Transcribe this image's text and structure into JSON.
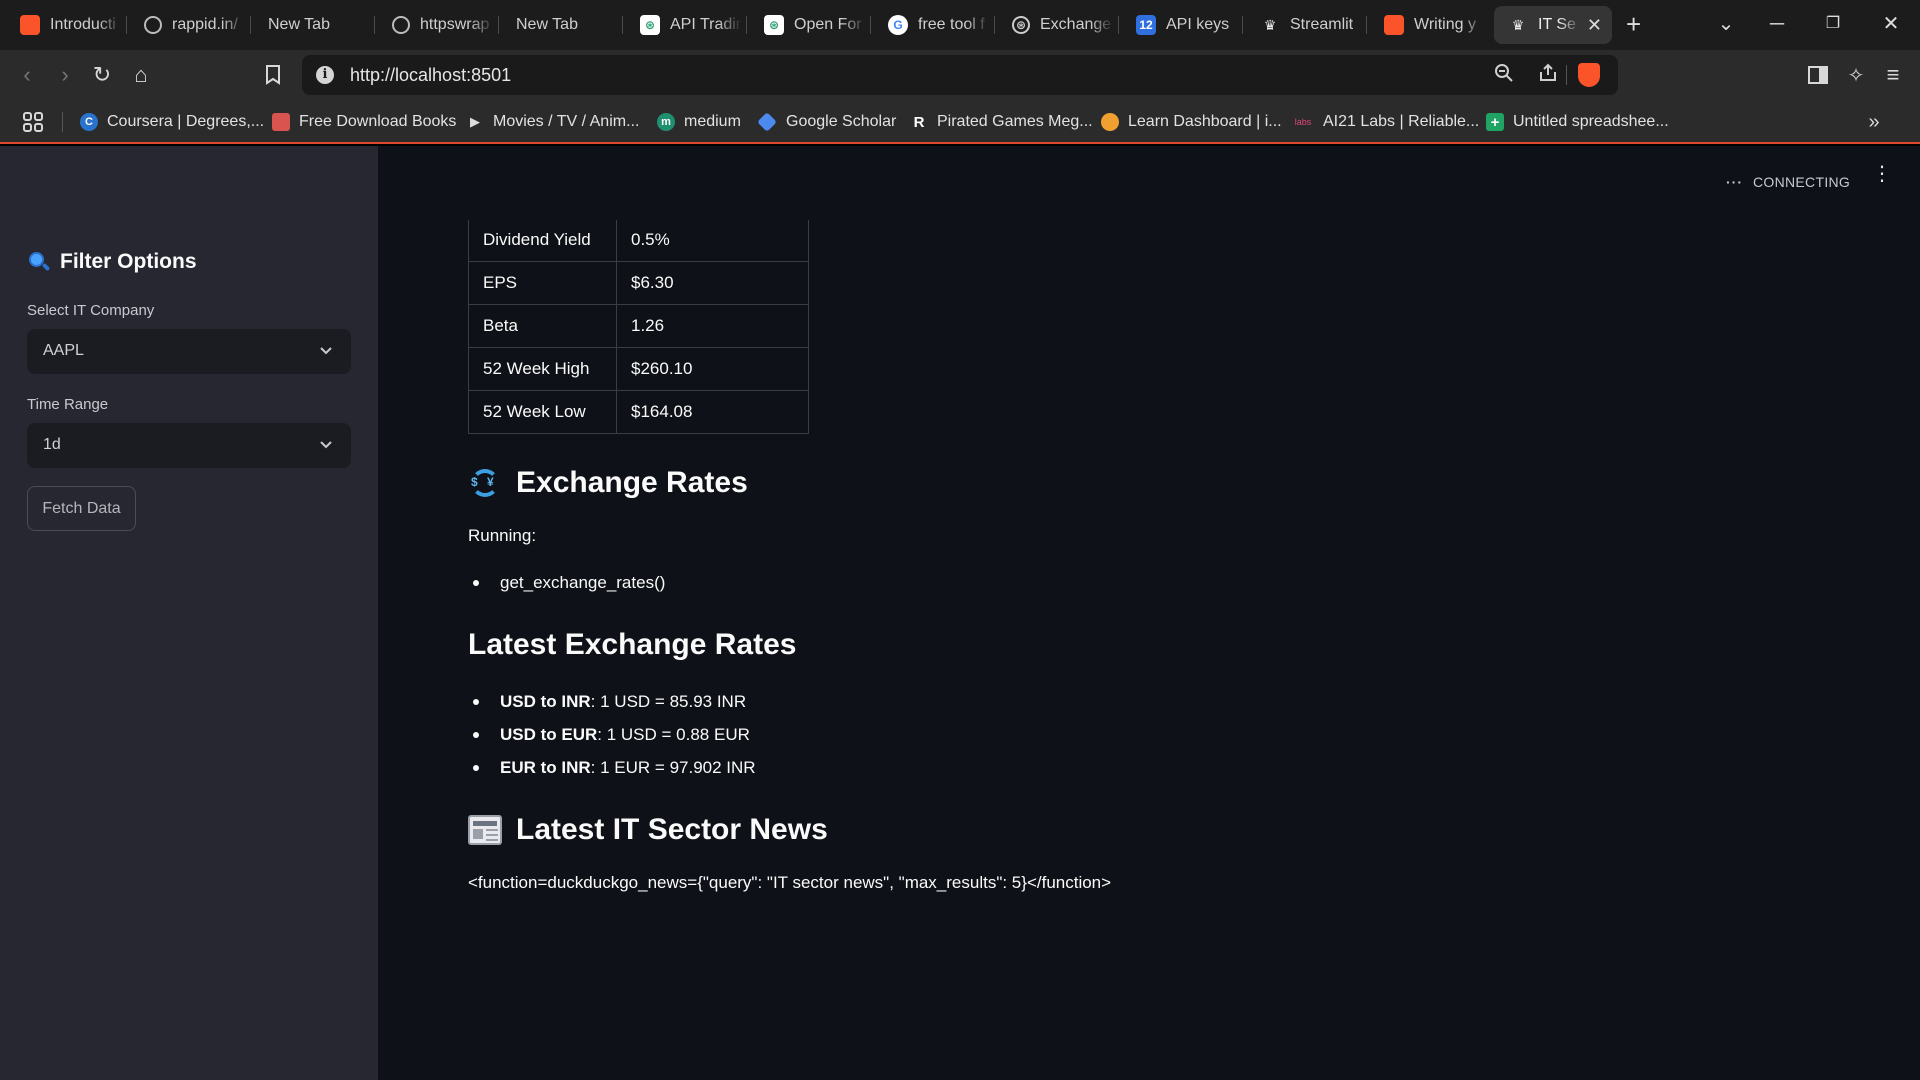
{
  "browser": {
    "tabs": [
      {
        "label": "Introducti",
        "icon": "orange-square-icon",
        "color": "#fb542b"
      },
      {
        "label": "rappid.in/",
        "icon": "globe-icon",
        "color": "#555555"
      },
      {
        "label": "New Tab",
        "icon": "",
        "color": ""
      },
      {
        "label": "httpswrap",
        "icon": "globe-icon",
        "color": "#555555"
      },
      {
        "label": "New Tab",
        "icon": "",
        "color": ""
      },
      {
        "label": "API Tradin",
        "icon": "openai-icon",
        "color": "#ffffff"
      },
      {
        "label": "Open For",
        "icon": "openai-icon",
        "color": "#ffffff"
      },
      {
        "label": "free tool f",
        "icon": "google-icon",
        "color": "#ffffff"
      },
      {
        "label": "Exchange",
        "icon": "openai-icon",
        "color": "#555555"
      },
      {
        "label": "API keys",
        "icon": "12-icon",
        "color": "#2f6fde"
      },
      {
        "label": "Streamlit",
        "icon": "streamlit-icon",
        "color": "#1c1c1c"
      },
      {
        "label": "Writing y",
        "icon": "orange-square-icon",
        "color": "#fb542b"
      },
      {
        "label": "IT Se",
        "icon": "streamlit-icon",
        "color": "#353535"
      }
    ],
    "url": "http://localhost:8501",
    "bookmarks": [
      {
        "label": "Coursera | Degrees,...",
        "icon_text": "C",
        "color": "#2a73cc"
      },
      {
        "label": "Free Download Books",
        "icon_text": "",
        "color": "#d9534f"
      },
      {
        "label": "Movies / TV / Anim...",
        "icon_text": "▶",
        "color": "#2b2b2b"
      },
      {
        "label": "medium",
        "icon_text": "m",
        "color": "#1f8f6f"
      },
      {
        "label": "Google Scholar",
        "icon_text": "",
        "color": "#4d8af0"
      },
      {
        "label": "Pirated Games Meg...",
        "icon_text": "R",
        "color": "#2b2b2b"
      },
      {
        "label": "Learn Dashboard | i...",
        "icon_text": "",
        "color": "#f0a030"
      },
      {
        "label": "AI21 Labs | Reliable...",
        "icon_text": "labs",
        "color": "#2b2b2b"
      },
      {
        "label": "Untitled spreadshee...",
        "icon_text": "+",
        "color": "#1fa463"
      }
    ]
  },
  "app": {
    "status": "CONNECTING",
    "sidebar": {
      "title": "Filter Options",
      "company_label": "Select IT Company",
      "company_value": "AAPL",
      "range_label": "Time Range",
      "range_value": "1d",
      "fetch_button": "Fetch Data"
    },
    "metrics": [
      {
        "key": "Dividend Yield",
        "value": "0.5%"
      },
      {
        "key": "EPS",
        "value": "$6.30"
      },
      {
        "key": "Beta",
        "value": "1.26"
      },
      {
        "key": "52 Week High",
        "value": "$260.10"
      },
      {
        "key": "52 Week Low",
        "value": "$164.08"
      }
    ],
    "exchange": {
      "heading": "Exchange Rates",
      "running_label": "Running:",
      "running_item": "get_exchange_rates()",
      "latest_heading": "Latest Exchange Rates",
      "rates": [
        {
          "pair": "USD to INR",
          "text": ": 1 USD = 85.93 INR"
        },
        {
          "pair": "USD to EUR",
          "text": ": 1 USD = 0.88 EUR"
        },
        {
          "pair": "EUR to INR",
          "text": ": 1 EUR = 97.902 INR"
        }
      ]
    },
    "news": {
      "heading": "Latest IT Sector News",
      "text": "<function=duckduckgo_news={\"query\": \"IT sector news\", \"max_results\": 5}</function>"
    }
  }
}
